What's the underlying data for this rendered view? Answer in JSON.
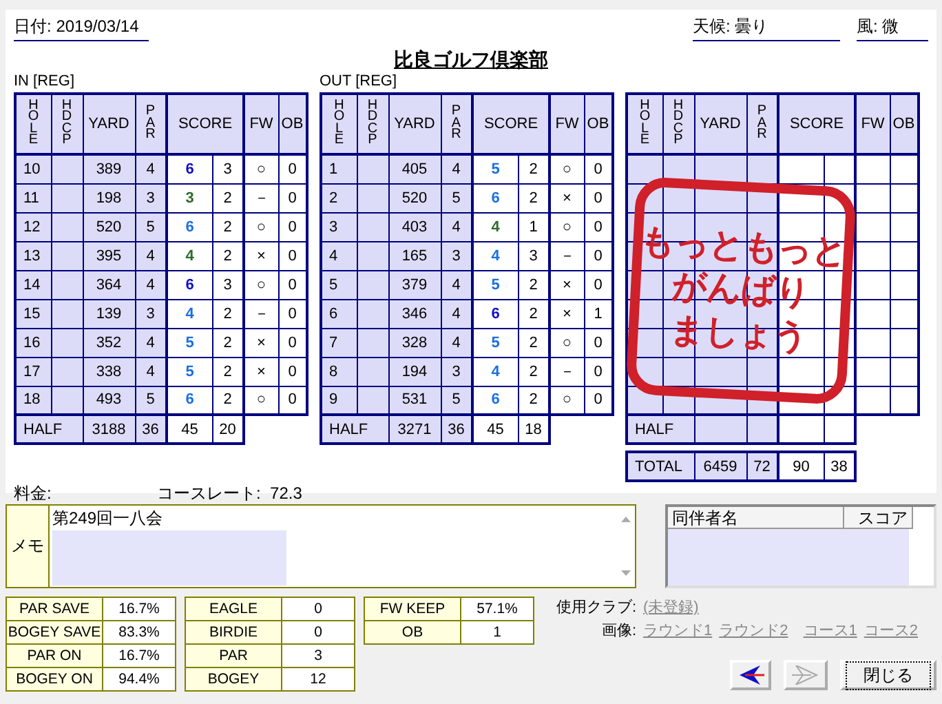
{
  "date": {
    "label": "日付:",
    "value": "2019/03/14"
  },
  "weather": {
    "label": "天候:",
    "value": "曇り"
  },
  "wind": {
    "label": "風:",
    "value": "微"
  },
  "club_name": "比良ゴルフ倶楽部",
  "scorecards": [
    {
      "label": "IN [REG]",
      "columns": [
        {
          "label": "HOLE",
          "kind": "vertical"
        },
        {
          "label": "HDCP",
          "kind": "vertical"
        },
        {
          "label": "YARD",
          "kind": "plain"
        },
        {
          "label": "PAR",
          "kind": "vertical"
        },
        {
          "label": "SCORE",
          "kind": "score"
        },
        {
          "label": "FW",
          "kind": "plain"
        },
        {
          "label": "OB",
          "kind": "plain"
        }
      ],
      "holes": [
        {
          "hole": "10",
          "yard": "389",
          "par": "4",
          "score": "6",
          "putts": "3",
          "fw": "○",
          "ob": "0",
          "color": "#1010c8"
        },
        {
          "hole": "11",
          "yard": "198",
          "par": "3",
          "score": "3",
          "putts": "2",
          "fw": "－",
          "ob": "0",
          "color": "#2e6b2e"
        },
        {
          "hole": "12",
          "yard": "520",
          "par": "5",
          "score": "6",
          "putts": "2",
          "fw": "○",
          "ob": "0",
          "color": "#1a6fe0"
        },
        {
          "hole": "13",
          "yard": "395",
          "par": "4",
          "score": "4",
          "putts": "2",
          "fw": "×",
          "ob": "0",
          "color": "#2e6b2e"
        },
        {
          "hole": "14",
          "yard": "364",
          "par": "4",
          "score": "6",
          "putts": "3",
          "fw": "○",
          "ob": "0",
          "color": "#1010c8"
        },
        {
          "hole": "15",
          "yard": "139",
          "par": "3",
          "score": "4",
          "putts": "2",
          "fw": "－",
          "ob": "0",
          "color": "#1a6fe0"
        },
        {
          "hole": "16",
          "yard": "352",
          "par": "4",
          "score": "5",
          "putts": "2",
          "fw": "×",
          "ob": "0",
          "color": "#1a6fe0"
        },
        {
          "hole": "17",
          "yard": "338",
          "par": "4",
          "score": "5",
          "putts": "2",
          "fw": "×",
          "ob": "0",
          "color": "#1a6fe0"
        },
        {
          "hole": "18",
          "yard": "493",
          "par": "5",
          "score": "6",
          "putts": "2",
          "fw": "○",
          "ob": "0",
          "color": "#1a6fe0"
        }
      ],
      "half": {
        "label": "HALF",
        "yard": "3188",
        "par": "36",
        "score": "45",
        "putts": "20"
      }
    },
    {
      "label": "OUT [REG]",
      "columns": [
        {
          "label": "HOLE",
          "kind": "vertical"
        },
        {
          "label": "HDCP",
          "kind": "vertical"
        },
        {
          "label": "YARD",
          "kind": "plain"
        },
        {
          "label": "PAR",
          "kind": "vertical"
        },
        {
          "label": "SCORE",
          "kind": "score"
        },
        {
          "label": "FW",
          "kind": "plain"
        },
        {
          "label": "OB",
          "kind": "plain"
        }
      ],
      "holes": [
        {
          "hole": "1",
          "yard": "405",
          "par": "4",
          "score": "5",
          "putts": "2",
          "fw": "○",
          "ob": "0",
          "color": "#1a6fe0"
        },
        {
          "hole": "2",
          "yard": "520",
          "par": "5",
          "score": "6",
          "putts": "2",
          "fw": "×",
          "ob": "0",
          "color": "#1a6fe0"
        },
        {
          "hole": "3",
          "yard": "403",
          "par": "4",
          "score": "4",
          "putts": "1",
          "fw": "○",
          "ob": "0",
          "color": "#2e6b2e"
        },
        {
          "hole": "4",
          "yard": "165",
          "par": "3",
          "score": "4",
          "putts": "3",
          "fw": "－",
          "ob": "0",
          "color": "#1a6fe0"
        },
        {
          "hole": "5",
          "yard": "379",
          "par": "4",
          "score": "5",
          "putts": "2",
          "fw": "×",
          "ob": "0",
          "color": "#1a6fe0"
        },
        {
          "hole": "6",
          "yard": "346",
          "par": "4",
          "score": "6",
          "putts": "2",
          "fw": "×",
          "ob": "1",
          "color": "#1010c8"
        },
        {
          "hole": "7",
          "yard": "328",
          "par": "4",
          "score": "5",
          "putts": "2",
          "fw": "○",
          "ob": "0",
          "color": "#1a6fe0"
        },
        {
          "hole": "8",
          "yard": "194",
          "par": "3",
          "score": "4",
          "putts": "2",
          "fw": "－",
          "ob": "0",
          "color": "#1a6fe0"
        },
        {
          "hole": "9",
          "yard": "531",
          "par": "5",
          "score": "6",
          "putts": "2",
          "fw": "○",
          "ob": "0",
          "color": "#1a6fe0"
        }
      ],
      "half": {
        "label": "HALF",
        "yard": "3271",
        "par": "36",
        "score": "45",
        "putts": "18"
      }
    },
    {
      "columns": [
        {
          "label": "HOLE",
          "kind": "vertical"
        },
        {
          "label": "HDCP",
          "kind": "vertical"
        },
        {
          "label": "YARD",
          "kind": "plain"
        },
        {
          "label": "PAR",
          "kind": "vertical"
        },
        {
          "label": "SCORE",
          "kind": "score"
        },
        {
          "label": "FW",
          "kind": "plain"
        },
        {
          "label": "OB",
          "kind": "plain"
        }
      ],
      "half": {
        "label": "HALF"
      },
      "total": {
        "label": "TOTAL",
        "yard": "6459",
        "par": "72",
        "score": "90",
        "putts": "38"
      },
      "stamp": [
        "もっともっと",
        "がんばり",
        "ましょう"
      ]
    }
  ],
  "fee": {
    "label": "料金:"
  },
  "course_rating": {
    "label": "コースレート:",
    "value": "72.3"
  },
  "memo": {
    "label": "メモ",
    "value": "第249回一八会"
  },
  "companions": {
    "columns": [
      "同伴者名",
      "スコア"
    ]
  },
  "stats": [
    [
      {
        "label": "PAR SAVE",
        "value": "16.7%"
      },
      {
        "label": "BOGEY SAVE",
        "value": "83.3%"
      },
      {
        "label": "PAR ON",
        "value": "16.7%"
      },
      {
        "label": "BOGEY ON",
        "value": "94.4%"
      }
    ],
    [
      {
        "label": "EAGLE",
        "value": "0"
      },
      {
        "label": "BIRDIE",
        "value": "0"
      },
      {
        "label": "PAR",
        "value": "3"
      },
      {
        "label": "BOGEY",
        "value": "12"
      }
    ],
    [
      {
        "label": "FW KEEP",
        "value": "57.1%"
      },
      {
        "label": "OB",
        "value": "1"
      }
    ]
  ],
  "clubs": {
    "label": "使用クラブ:",
    "link": "(未登録)"
  },
  "images": {
    "label": "画像:",
    "links": [
      "ラウンド1",
      "ラウンド2",
      "コース1",
      "コース2"
    ]
  },
  "buttons": [
    {
      "kind": "back",
      "disabled": false
    },
    {
      "kind": "forward",
      "disabled": true
    },
    {
      "kind": "close",
      "label": "閉じる",
      "focused": true
    }
  ]
}
